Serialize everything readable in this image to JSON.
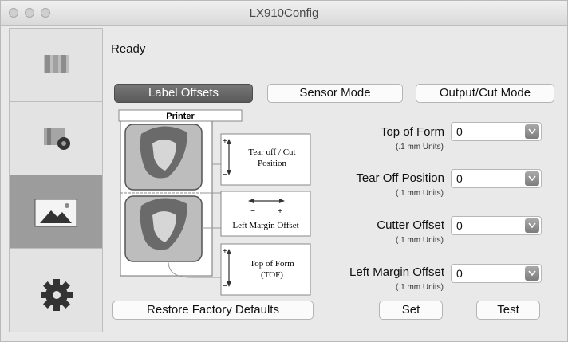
{
  "window": {
    "title": "LX910Config"
  },
  "status": "Ready",
  "tabs": [
    {
      "label": "Label Offsets"
    },
    {
      "label": "Sensor Mode"
    },
    {
      "label": "Output/Cut Mode"
    }
  ],
  "diagram": {
    "printer_label": "Printer",
    "tear_label_line1": "Tear off / Cut",
    "tear_label_line2": "Position",
    "left_margin_label": "Left Margin Offset",
    "tof_label_line1": "Top of Form",
    "tof_label_line2": "(TOF)",
    "plus": "+",
    "minus": "−"
  },
  "fields": [
    {
      "label": "Top of Form",
      "unit": "(.1 mm Units)",
      "value": "0"
    },
    {
      "label": "Tear Off Position",
      "unit": "(.1 mm Units)",
      "value": "0"
    },
    {
      "label": "Cutter Offset",
      "unit": "(.1 mm Units)",
      "value": "0"
    },
    {
      "label": "Left Margin Offset",
      "unit": "(.1 mm Units)",
      "value": "0"
    }
  ],
  "buttons": {
    "restore": "Restore Factory Defaults",
    "set": "Set",
    "test": "Test"
  }
}
